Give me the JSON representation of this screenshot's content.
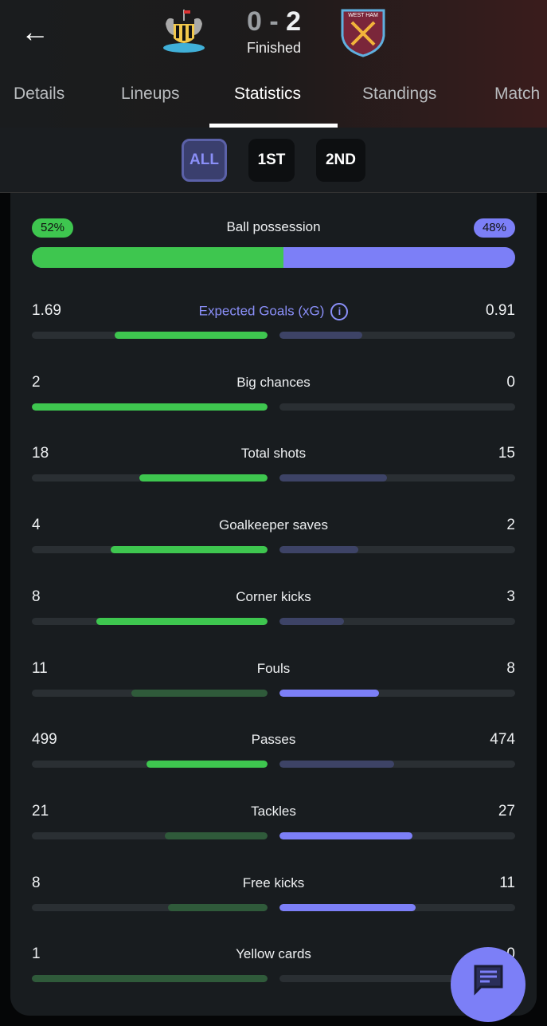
{
  "header": {
    "back_icon": "arrow-left-icon",
    "home_team_crest": "Newcastle United",
    "away_team_crest": "West Ham United",
    "home_score": "0",
    "separator": "-",
    "away_score": "2",
    "status": "Finished"
  },
  "tabs": [
    {
      "label": "Details"
    },
    {
      "label": "Lineups"
    },
    {
      "label": "Statistics",
      "active": true
    },
    {
      "label": "Standings"
    },
    {
      "label": "Match"
    }
  ],
  "periods": [
    {
      "label": "ALL",
      "active": true
    },
    {
      "label": "1ST"
    },
    {
      "label": "2ND"
    }
  ],
  "colors": {
    "home": "#3ec64f",
    "home_dim": "#2f5a3a",
    "away": "#7c7ff7",
    "away_dim": "#3d4366",
    "track": "#2a2f33"
  },
  "possession": {
    "label": "Ball possession",
    "home": "52%",
    "away": "48%",
    "home_value": 52
  },
  "stats": [
    {
      "label": "Expected Goals (xG)",
      "home": "1.69",
      "away": "0.91",
      "info": true,
      "highlight": "home"
    },
    {
      "label": "Big chances",
      "home": "2",
      "away": "0",
      "highlight": "home"
    },
    {
      "label": "Total shots",
      "home": "18",
      "away": "15",
      "highlight": "home"
    },
    {
      "label": "Goalkeeper saves",
      "home": "4",
      "away": "2",
      "highlight": "home"
    },
    {
      "label": "Corner kicks",
      "home": "8",
      "away": "3",
      "highlight": "home"
    },
    {
      "label": "Fouls",
      "home": "11",
      "away": "8",
      "highlight": "away"
    },
    {
      "label": "Passes",
      "home": "499",
      "away": "474",
      "highlight": "home"
    },
    {
      "label": "Tackles",
      "home": "21",
      "away": "27",
      "highlight": "away"
    },
    {
      "label": "Free kicks",
      "home": "8",
      "away": "11",
      "highlight": "away"
    },
    {
      "label": "Yellow cards",
      "home": "1",
      "away": "0",
      "highlight": "none"
    }
  ],
  "fab": {
    "icon": "chat-icon"
  }
}
